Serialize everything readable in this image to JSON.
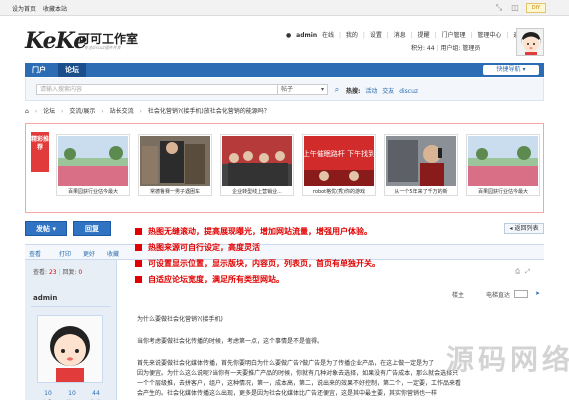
{
  "topbar": {
    "left": [
      "设为首页",
      "收藏本站"
    ],
    "diy": "DIY"
  },
  "logo": {
    "mark": "KeKe",
    "name": "可可工作室",
    "sub": "专注discuz插件开发"
  },
  "user": {
    "name": "admin",
    "status": "在线",
    "menu": [
      "我的",
      "设置",
      "消息",
      "提醒",
      "门户管理",
      "管理中心",
      "退出"
    ],
    "credits_label": "积分: 44",
    "group_label": "用户组: 管理员"
  },
  "nav": {
    "tabs": [
      "门户",
      "论坛"
    ],
    "quick": "快捷导航"
  },
  "search": {
    "placeholder": "请输入搜索内容",
    "scope": "帖子",
    "hot_label": "热搜:",
    "hot_words": [
      "活动",
      "交友",
      "discuz"
    ]
  },
  "breadcrumb": [
    "论坛",
    "交流/展示",
    "站长交流",
    "社会化营销?(接手机)放社会化营销的能源吗？"
  ],
  "slider": {
    "tag": "精彩推荐",
    "items": [
      {
        "caption": "百果园获行业估今最大"
      },
      {
        "caption": "常德鲁赛一男子遇困车"
      },
      {
        "caption": "企业转型线上营销业..."
      },
      {
        "caption": "robot格优(秀)你的游戏"
      },
      {
        "caption": "从一个5年来了千万的新"
      },
      {
        "caption": "百果园获行业估今最大"
      }
    ]
  },
  "slider_banner": "上午催眠路杆 下午找到",
  "actions": {
    "post": "发帖",
    "reply": "回复",
    "back": "返回列表"
  },
  "promo": [
    "热图无缝滚动，提高展现曝光，增加网站流量，增强用户体验。",
    "热图来源可自行设定，高度灵活",
    "可设置显示位置，显示版块，内容页，列表页，首页有单独开关。",
    "自适应论坛宽度，满足所有类型网站。"
  ],
  "toolbar": [
    "查看",
    "打印",
    "更好",
    "收藏"
  ],
  "stats": {
    "views_label": "查看:",
    "views": "23",
    "replies_label": "回复:",
    "replies": "0"
  },
  "post": {
    "author": "admin",
    "user_stats": [
      {
        "n": "10",
        "l": "主题"
      },
      {
        "n": "10",
        "l": "帖子"
      },
      {
        "n": "44",
        "l": "积分"
      }
    ],
    "floor": "楼主",
    "floor_tail": "电梯直达",
    "title": "为什么要做社会化营销?(接手机)",
    "lines": [
      "当你考虑要做社会化传播的时候，考虑第一点，这个事情是不是值得。",
      "首先来说要做社会化媒体传播，首先你要明白为什么要做广告?做广告是为了传播企业产品，在这上做一定是为了",
      "因为便宜。为什么这么说呢?当你有一天要推广产品的时候，你就有几种对象去选择，如果没有广告成本，那么就会选择只",
      "一个个层级推，去拼客户，组户，这种情况，第一，成本高，第二，说出来的效果不好控制，第二个，一定要，工作品来看",
      "会产生的。社会化媒体传播这么出现，更多是因为社会化媒体比广告还便宜，这是其中最主要，其实你营销也一样"
    ]
  },
  "watermark": "源码网络"
}
